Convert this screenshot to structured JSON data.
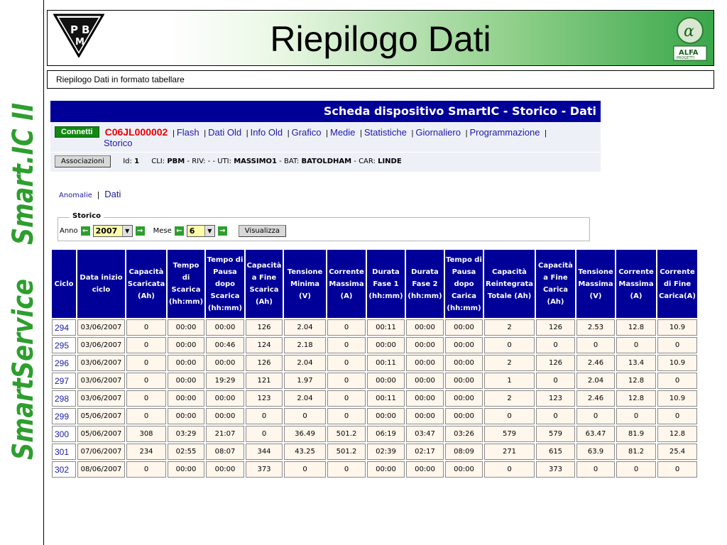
{
  "brand": {
    "side_text": "SmartService  Smart.IC II",
    "logo_left": "PBM",
    "logo_right": "ALFA PROGETTI",
    "brand_green": "#2e9e2e"
  },
  "header": {
    "title": "Riepilogo Dati",
    "subtitle": "Riepilogo Dati in formato tabellare"
  },
  "panel": {
    "title": "Scheda dispositivo SmartIC - Storico - Dati",
    "connect_label": "Connetti",
    "device_id": "C06JL000002",
    "nav": [
      "Flash",
      "Dati Old",
      "Info Old",
      "Grafico",
      "Medie",
      "Statistiche",
      "Giornaliero",
      "Programmazione",
      "Storico"
    ],
    "assoc_label": "Associazioni",
    "id_label": "Id:",
    "id_value": "1",
    "cli_label": "CLI:",
    "cli_value": "PBM",
    "riv_label": "- RIV: -",
    "uti_label": "- UTI:",
    "uti_value": "MASSIMO1",
    "bat_label": "- BAT:",
    "bat_value": "BATOLDHAM",
    "car_label": "- CAR:",
    "car_value": "LINDE"
  },
  "subtabs": {
    "anomalie": "Anomalie",
    "dati": "Dati"
  },
  "storico": {
    "legend": "Storico",
    "anno_label": "Anno",
    "anno_value": "2007",
    "mese_label": "Mese",
    "mese_value": "6",
    "visualizza": "Visualizza"
  },
  "table": {
    "headers": [
      "Ciclo",
      "Data inizio ciclo",
      "Capacità Scaricata (Ah)",
      "Tempo di Scarica (hh:mm)",
      "Tempo di Pausa dopo Scarica (hh:mm)",
      "Capacità a Fine Scarica (Ah)",
      "Tensione Minima (V)",
      "Corrente Massima (A)",
      "Durata Fase 1 (hh:mm)",
      "Durata Fase 2 (hh:mm)",
      "Tempo di Pausa dopo Carica (hh:mm)",
      "Capacità Reintegrata Totale (Ah)",
      "Capacità a Fine Carica (Ah)",
      "Tensione Massima (V)",
      "Corrente Massima (A)",
      "Corrente di Fine Carica(A)"
    ],
    "rows": [
      [
        "294",
        "03/06/2007",
        "0",
        "00:00",
        "00:00",
        "126",
        "2.04",
        "0",
        "00:11",
        "00:00",
        "00:00",
        "2",
        "126",
        "2.53",
        "12.8",
        "10.9"
      ],
      [
        "295",
        "03/06/2007",
        "0",
        "00:00",
        "00:46",
        "124",
        "2.18",
        "0",
        "00:00",
        "00:00",
        "00:00",
        "0",
        "0",
        "0",
        "0",
        "0"
      ],
      [
        "296",
        "03/06/2007",
        "0",
        "00:00",
        "00:00",
        "126",
        "2.04",
        "0",
        "00:11",
        "00:00",
        "00:00",
        "2",
        "126",
        "2.46",
        "13.4",
        "10.9"
      ],
      [
        "297",
        "03/06/2007",
        "0",
        "00:00",
        "19:29",
        "121",
        "1.97",
        "0",
        "00:00",
        "00:00",
        "00:00",
        "1",
        "0",
        "2.04",
        "12.8",
        "0"
      ],
      [
        "298",
        "03/06/2007",
        "0",
        "00:00",
        "00:00",
        "123",
        "2.04",
        "0",
        "00:11",
        "00:00",
        "00:00",
        "2",
        "123",
        "2.46",
        "12.8",
        "10.9"
      ],
      [
        "299",
        "05/06/2007",
        "0",
        "00:00",
        "00:00",
        "0",
        "0",
        "0",
        "00:00",
        "00:00",
        "00:00",
        "0",
        "0",
        "0",
        "0",
        "0"
      ],
      [
        "300",
        "05/06/2007",
        "308",
        "03:29",
        "21:07",
        "0",
        "36.49",
        "501.2",
        "06:19",
        "03:47",
        "03:26",
        "579",
        "579",
        "63.47",
        "81.9",
        "12.8"
      ],
      [
        "301",
        "07/06/2007",
        "234",
        "02:55",
        "08:07",
        "344",
        "43.25",
        "501.2",
        "02:39",
        "02:17",
        "08:09",
        "271",
        "615",
        "63.9",
        "81.2",
        "25.4"
      ],
      [
        "302",
        "08/06/2007",
        "0",
        "00:00",
        "00:00",
        "373",
        "0",
        "0",
        "00:00",
        "00:00",
        "00:00",
        "0",
        "373",
        "0",
        "0",
        "0"
      ]
    ]
  }
}
